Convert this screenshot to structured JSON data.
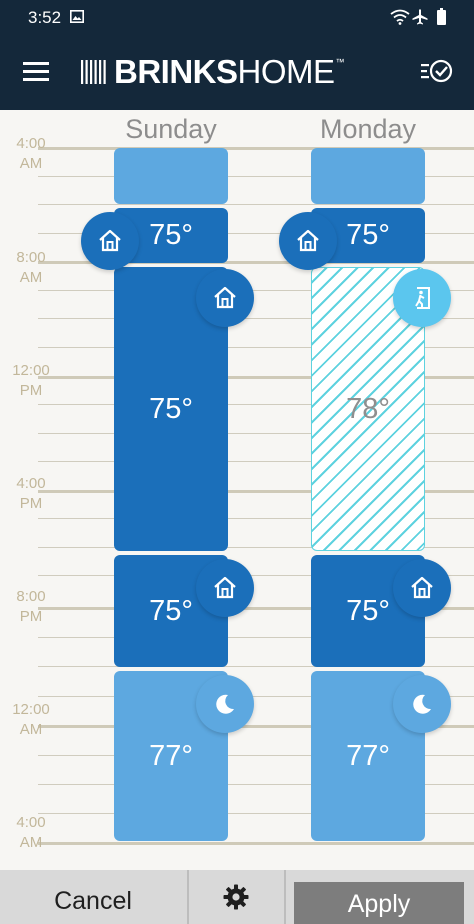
{
  "status_bar": {
    "time": "3:52",
    "icons": [
      "image-icon",
      "wifi-icon",
      "airplane-icon",
      "battery-icon"
    ]
  },
  "header": {
    "logo_bold": "BRINKS",
    "logo_light": "HOME",
    "logo_tm": "™",
    "menu_icon": "hamburger-menu-icon",
    "schedule_icon": "schedule-list-check-icon"
  },
  "colors": {
    "header_bg": "#14283a",
    "light_block": "#5da8e0",
    "dark_block": "#1b6fba",
    "away_stripe": "#5ed2df",
    "time_label": "#c2b79a"
  },
  "time_labels": [
    {
      "line1": "4:00",
      "line2": "AM"
    },
    {
      "line1": "8:00",
      "line2": "AM"
    },
    {
      "line1": "12:00",
      "line2": "PM"
    },
    {
      "line1": "4:00",
      "line2": "PM"
    },
    {
      "line1": "8:00",
      "line2": "PM"
    },
    {
      "line1": "12:00",
      "line2": "AM"
    },
    {
      "line1": "4:00",
      "line2": "AM"
    }
  ],
  "days": [
    {
      "name": "Sunday",
      "blocks": [
        {
          "temp": "",
          "mode": "sleep"
        },
        {
          "temp": "75°",
          "mode": "home"
        },
        {
          "temp": "75°",
          "mode": "home"
        },
        {
          "temp": "75°",
          "mode": "home"
        },
        {
          "temp": "77°",
          "mode": "sleep"
        }
      ]
    },
    {
      "name": "Monday",
      "blocks": [
        {
          "temp": "",
          "mode": "sleep"
        },
        {
          "temp": "75°",
          "mode": "home"
        },
        {
          "temp": "78°",
          "mode": "away"
        },
        {
          "temp": "75°",
          "mode": "home"
        },
        {
          "temp": "77°",
          "mode": "sleep"
        }
      ]
    }
  ],
  "footer": {
    "cancel_label": "Cancel",
    "settings_icon": "gear-icon",
    "apply_label": "Apply"
  }
}
